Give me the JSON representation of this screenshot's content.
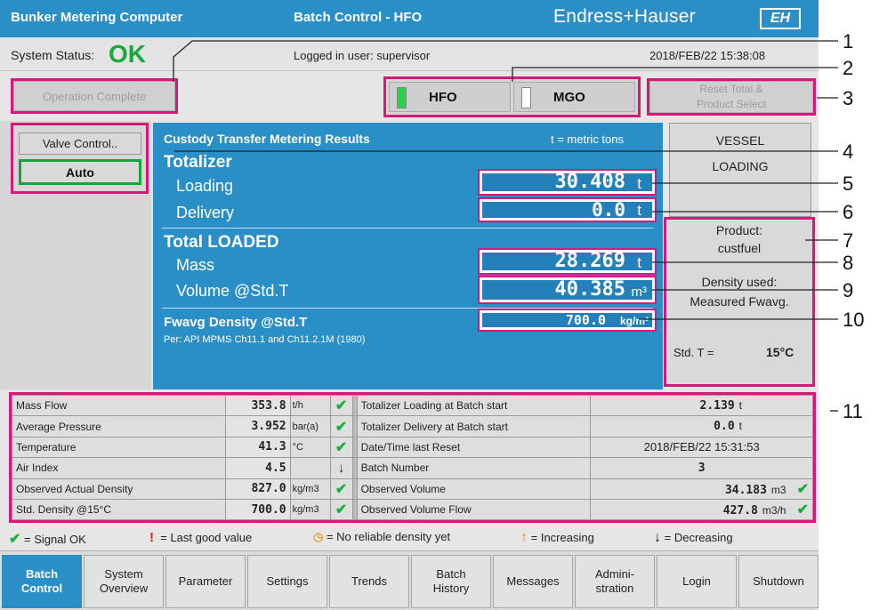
{
  "title_bar": {
    "app_title": "Bunker Metering Computer",
    "screen_title": "Batch Control - HFO",
    "brand": "Endress+Hauser",
    "brand_mark": "EH"
  },
  "status_bar": {
    "label": "System Status:",
    "status": "OK",
    "user": "Logged in user: supervisor",
    "datetime": "2018/FEB/22  15:38:08"
  },
  "buttons": {
    "operation_complete": "Operation Complete",
    "reset_line1": "Reset Total &",
    "reset_line2": "Product Select",
    "valve_control": "Valve Control..",
    "auto": "Auto"
  },
  "product_select": [
    {
      "label": "HFO",
      "indicator": "#27d14a"
    },
    {
      "label": "MGO",
      "indicator": "#ffffff"
    }
  ],
  "metering": {
    "title": "Custody Transfer Metering Results",
    "units_note": "t = metric tons",
    "totalizer_heading": "Totalizer",
    "loading_label": "Loading",
    "loading_value": "30.408",
    "loading_unit": "t",
    "delivery_label": "Delivery",
    "delivery_value": "0.0",
    "delivery_unit": "t",
    "total_loaded_heading": "Total LOADED",
    "mass_label": "Mass",
    "mass_value": "28.269",
    "mass_unit": "t",
    "volume_label": "Volume @Std.T",
    "volume_value": "40.385",
    "volume_unit": "m³",
    "density_label": "Fwavg Density @Std.T",
    "density_note": "Per: API MPMS Ch11.1 and Ch11.2.1M (1980)",
    "density_value": "700.0",
    "density_unit": "kg/m³"
  },
  "vessel": {
    "line1": "VESSEL",
    "line2": "LOADING"
  },
  "product_info": {
    "product_label": "Product:",
    "product_value": "custfuel",
    "density_label": "Density used:",
    "density_value": "Measured Fwavg.",
    "stdt_label": "Std. T =",
    "stdt_value": "15°C"
  },
  "table": {
    "left": [
      {
        "label": "Mass Flow",
        "value": "353.8",
        "unit": "t/h",
        "status": "ok"
      },
      {
        "label": "Average Pressure",
        "value": "3.952",
        "unit": "bar(a)",
        "status": "ok"
      },
      {
        "label": "Temperature",
        "value": "41.3",
        "unit": "°C",
        "status": "ok"
      },
      {
        "label": "Air Index",
        "value": "4.5",
        "unit": "",
        "status": "down"
      },
      {
        "label": "Observed Actual Density",
        "value": "827.0",
        "unit": "kg/m3",
        "status": "ok"
      },
      {
        "label": "Std. Density @15°C",
        "value": "700.0",
        "unit": "kg/m3",
        "status": "ok"
      }
    ],
    "right": [
      {
        "label": "Totalizer Loading at Batch start",
        "value": "2.139",
        "unit": "t",
        "status": ""
      },
      {
        "label": "Totalizer Delivery at Batch start",
        "value": "0.0",
        "unit": "t",
        "status": ""
      },
      {
        "label": "Date/Time last Reset",
        "value": "2018/FEB/22 15:31:53",
        "unit": "",
        "status": ""
      },
      {
        "label": "Batch Number",
        "value": "3",
        "unit": "",
        "status": ""
      },
      {
        "label": "Observed Volume",
        "value": "34.183",
        "unit": "m3",
        "status": "ok"
      },
      {
        "label": "Observed Volume Flow",
        "value": "427.8",
        "unit": "m3/h",
        "status": "ok"
      }
    ]
  },
  "legend": {
    "ok": "= Signal OK",
    "last": "= Last good value",
    "nodens": "= No reliable density yet",
    "inc": "= Increasing",
    "dec": "= Decreasing"
  },
  "nav": [
    {
      "line1": "Batch",
      "line2": "Control",
      "active": true
    },
    {
      "line1": "System",
      "line2": "Overview"
    },
    {
      "line1": "Parameter",
      "line2": ""
    },
    {
      "line1": "Settings",
      "line2": ""
    },
    {
      "line1": "Trends",
      "line2": ""
    },
    {
      "line1": "Batch",
      "line2": "History"
    },
    {
      "line1": "Messages",
      "line2": ""
    },
    {
      "line1": "Admini-",
      "line2": "stration"
    },
    {
      "line1": "Login",
      "line2": ""
    },
    {
      "line1": "Shutdown",
      "line2": ""
    }
  ],
  "callouts": [
    "1",
    "2",
    "3",
    "4",
    "5",
    "6",
    "7",
    "8",
    "9",
    "10",
    "11"
  ]
}
